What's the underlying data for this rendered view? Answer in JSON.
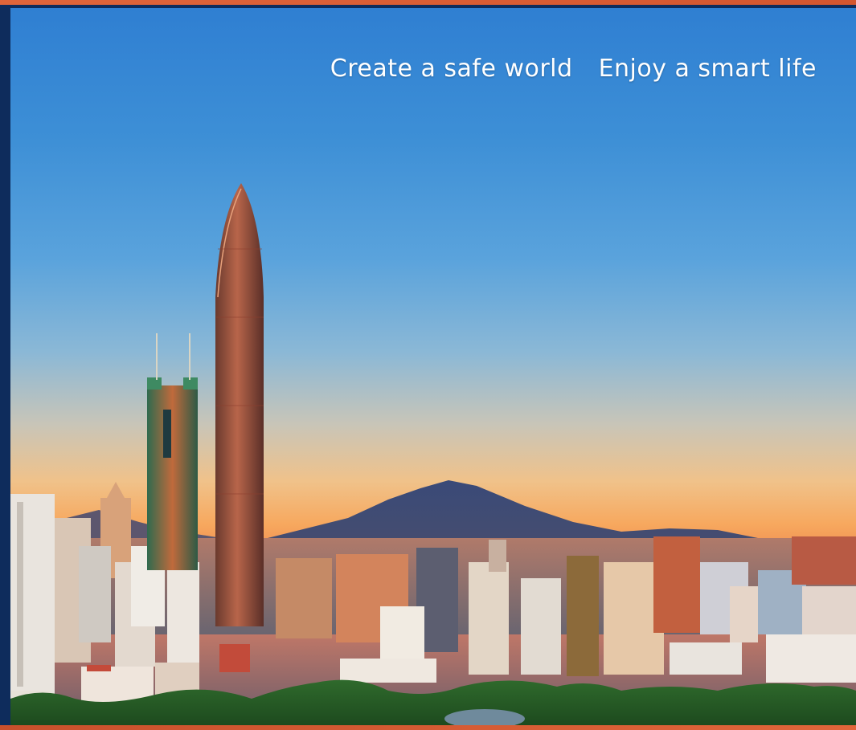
{
  "tagline": {
    "part1": "Create a safe world",
    "part2": "Enjoy a smart life"
  },
  "photo": {
    "subject": "city-skyline-at-dusk",
    "colors": {
      "frame": "#0e2c5c",
      "accent_band": "#e0653a",
      "sky_top": "#2f7fd2",
      "sky_horizon": "#f7a85e"
    }
  }
}
